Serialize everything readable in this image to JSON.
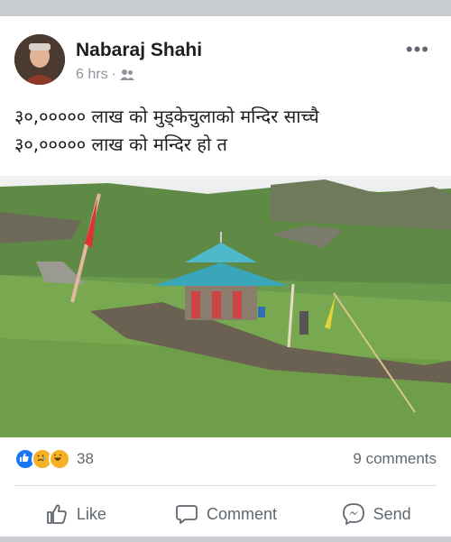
{
  "post": {
    "author": "Nabaraj Shahi",
    "time": "6 hrs",
    "separator": "·",
    "text_line1": "३०,००००० लाख को मुड्केचुलाको मन्दिर साच्चै",
    "text_line2": "३०,००००० लाख को मन्दिर हो त"
  },
  "stats": {
    "reaction_count": "38",
    "comments": "9 comments"
  },
  "actions": {
    "like": "Like",
    "comment": "Comment",
    "send": "Send"
  },
  "colors": {
    "like_blue": "#1877f2",
    "emoji_yellow": "#f7b125",
    "text": "#1c1e21",
    "secondary": "#606770",
    "roof_teal": "#3aa6b9"
  },
  "icons": {
    "audience": "friends-icon",
    "more": "more-options-icon",
    "like": "thumbs-up-icon",
    "comment": "speech-bubble-icon",
    "send": "messenger-icon"
  }
}
